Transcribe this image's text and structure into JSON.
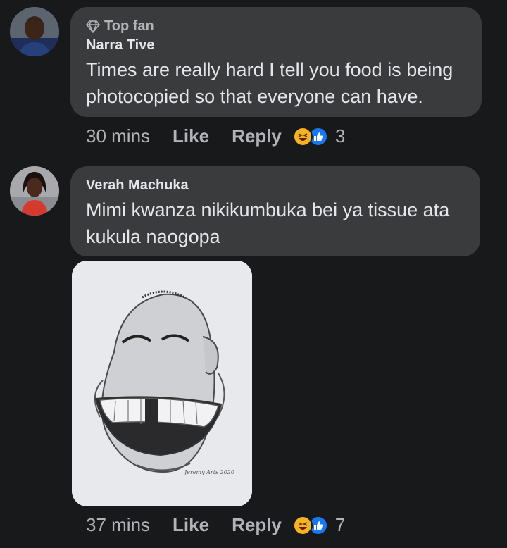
{
  "comments": [
    {
      "badge_icon": "diamond-icon",
      "badge": "Top fan",
      "author": "Narra Tive",
      "text_lines": [
        "Times are really hard I tell you food is being",
        "photocopied so that everyone can have."
      ],
      "time": "30 mins",
      "like_label": "Like",
      "reply_label": "Reply",
      "reaction_icons": [
        "haha-icon",
        "like-icon"
      ],
      "reaction_count": "3"
    },
    {
      "author": "Verah Machuka",
      "text_lines": [
        "Mimi kwanza nikikumbuka bei ya tissue ata",
        "kukula naogopa"
      ],
      "attachment": {
        "type": "sticker",
        "signature": "Jeremy Arts 2020"
      },
      "time": "37 mins",
      "like_label": "Like",
      "reply_label": "Reply",
      "reaction_icons": [
        "haha-icon",
        "like-icon"
      ],
      "reaction_count": "7"
    }
  ],
  "colors": {
    "background": "#18191a",
    "bubble": "#3a3b3c",
    "primary_text": "#e4e6eb",
    "secondary_text": "#b0b3b8",
    "like_blue": "#1877f2",
    "haha_yellow": "#f7b125"
  }
}
